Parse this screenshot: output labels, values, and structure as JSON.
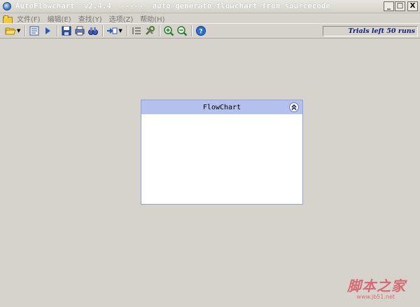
{
  "window": {
    "title": "AutoFlowchart  v2.4.4  -----  auto generate flowchart from sourcecode",
    "minimize_label": "_",
    "maximize_label": "□",
    "close_label": "X"
  },
  "menu": {
    "items": [
      "文件(F)",
      "编辑(E)",
      "查找(Y)",
      "选项(Z)",
      "帮助(H)"
    ]
  },
  "toolbar": {
    "buttons": [
      "open-folder",
      "page-setup",
      "run",
      "save",
      "print",
      "find",
      "insert",
      "list",
      "tools",
      "zoom-in",
      "zoom-out",
      "help"
    ],
    "trials_text": "Trials left 50 runs"
  },
  "flowchart": {
    "title": "FlowChart"
  },
  "watermark": {
    "chinese": "脚本之家",
    "url": "www.jb51.net"
  },
  "colors": {
    "background": "#d6d3cc",
    "panel_header": "#b4c0ee",
    "trials_text": "#0f1f7a",
    "watermark": "#d66b73"
  }
}
